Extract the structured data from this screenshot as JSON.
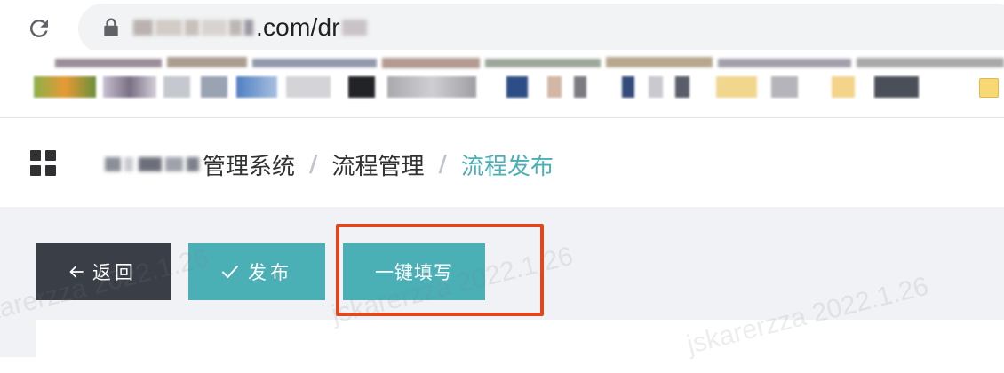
{
  "browser": {
    "url_visible": ".com/dr",
    "reload_icon": "reload-icon",
    "lock_icon": "lock-icon"
  },
  "breadcrumb": {
    "root_suffix": "管理系统",
    "separator": "/",
    "level2": "流程管理",
    "current": "流程发布"
  },
  "toolbar": {
    "back_label": "返回",
    "back_icon": "arrow-left-icon",
    "publish_label": "发布",
    "publish_icon": "check-icon",
    "fill_label": "一键填写"
  },
  "watermark": {
    "text": "jskarerzza 2022.1.26"
  },
  "colors": {
    "accent": "#4bafb6",
    "dark_button": "#3a3e47",
    "highlight": "#e2461f",
    "content_bg": "#f0f2f5"
  }
}
